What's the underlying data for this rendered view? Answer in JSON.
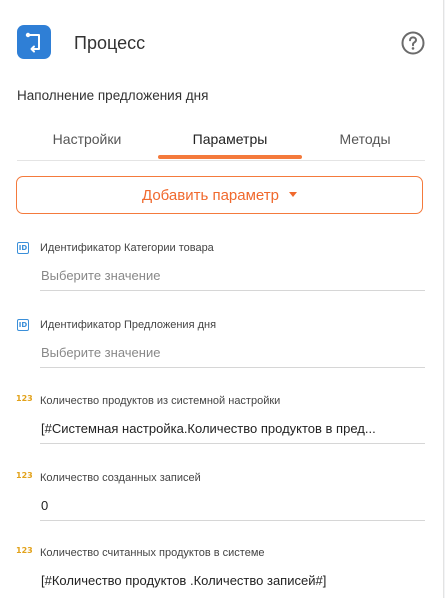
{
  "header": {
    "title": "Процесс",
    "subtitle": "Наполнение предложения дня",
    "process_icon": "process-flow-icon",
    "help_icon": "question-circle-icon"
  },
  "tabs": [
    {
      "label": "Настройки",
      "active": false
    },
    {
      "label": "Параметры",
      "active": true
    },
    {
      "label": "Методы",
      "active": false
    }
  ],
  "add_button": {
    "label": "Добавить параметр",
    "icon": "caret-down-icon"
  },
  "parameters": [
    {
      "type_icon": "id",
      "label": "Идентификатор Категории товара",
      "value": "Выберите значение",
      "is_placeholder": true
    },
    {
      "type_icon": "123",
      "label": "Идентификатор Предложения дня",
      "value": "Выберите значение",
      "is_placeholder": true
    },
    {
      "type_icon": "123",
      "label": "Количество продуктов из системной настройки",
      "value": "[#Системная настройка.Количество  продуктов в  пред...",
      "is_placeholder": false
    },
    {
      "type_icon": "123",
      "label": "Количество созданных записей",
      "value": "0",
      "is_placeholder": false
    },
    {
      "type_icon": "123",
      "label": "Количество считанных продуктов в системе",
      "value": "[#Количество продуктов .Количество записей#]",
      "is_placeholder": false
    }
  ],
  "colors": {
    "accent": "#f47a3c",
    "icon_blue": "#2f7fd6",
    "num_icon": "#e2a21b"
  }
}
